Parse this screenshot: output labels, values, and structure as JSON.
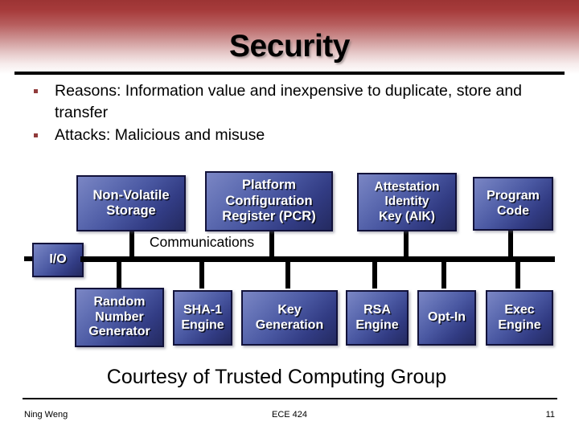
{
  "slide": {
    "title": "Security",
    "courtesy": "Courtesy of Trusted Computing Group"
  },
  "bullets": [
    {
      "text": "Reasons: Information value and inexpensive to duplicate, store and transfer"
    },
    {
      "text": "Attacks: Malicious and misuse"
    }
  ],
  "diagram": {
    "bus_label": "Communications",
    "io_node": {
      "label": "I/O"
    },
    "top_nodes": [
      {
        "line1": "Non-Volatile",
        "line2": "Storage",
        "line3": ""
      },
      {
        "line1": "Platform",
        "line2": "Configuration",
        "line3": "Register (PCR)"
      },
      {
        "line1": "Attestation",
        "line2": "Identity",
        "line3": "Key (AIK)"
      },
      {
        "line1": "Program",
        "line2": "Code",
        "line3": ""
      }
    ],
    "bottom_nodes": [
      {
        "line1": "Random",
        "line2": "Number",
        "line3": "Generator"
      },
      {
        "line1": "SHA-1",
        "line2": "Engine",
        "line3": ""
      },
      {
        "line1": "Key",
        "line2": "Generation",
        "line3": ""
      },
      {
        "line1": "RSA",
        "line2": "Engine",
        "line3": ""
      },
      {
        "line1": "Opt-In",
        "line2": "",
        "line3": ""
      },
      {
        "line1": "Exec",
        "line2": "Engine",
        "line3": ""
      }
    ]
  },
  "footer": {
    "author": "Ning Weng",
    "course": "ECE 424",
    "page": "11"
  },
  "colors": {
    "header_top": "#9c3434",
    "bullet_marker": "#913b3b",
    "node_border": "#12123a",
    "node_fill_light": "#7b86c4",
    "node_fill_dark": "#242a60",
    "line": "#000000"
  }
}
